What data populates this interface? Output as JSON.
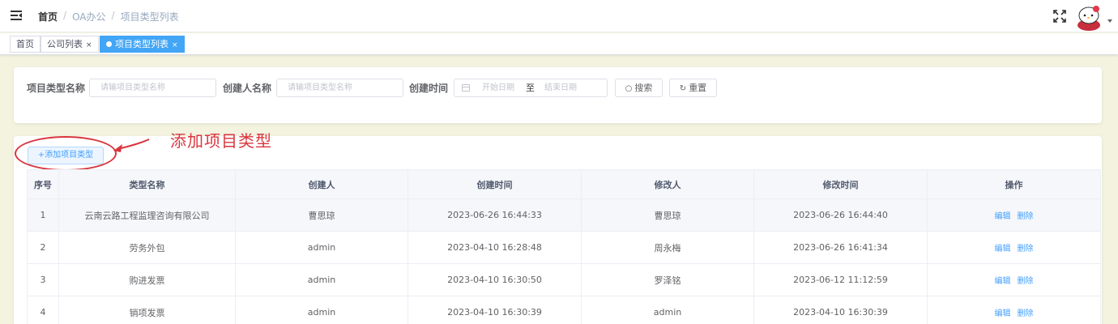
{
  "header": {
    "breadcrumb": [
      "首页",
      "OA办公",
      "项目类型列表"
    ],
    "icons": {
      "menu": "hamburger-icon",
      "fullscreen": "fullscreen-icon",
      "avatar": "hello-kitty-avatar",
      "caret": "caret-down-icon"
    }
  },
  "tags": [
    {
      "label": "首页",
      "active": false
    },
    {
      "label": "公司列表",
      "active": false,
      "closable": true
    },
    {
      "label": "项目类型列表",
      "active": true,
      "closable": true
    }
  ],
  "close_glyph": "×",
  "search": {
    "type_name_label": "项目类型名称",
    "type_name_placeholder": "请输项目类型名称",
    "creator_label": "创建人名称",
    "creator_placeholder": "请输项目类型名称",
    "time_label": "创建时间",
    "start_placeholder": "开始日期",
    "range_separator": "至",
    "end_placeholder": "结束日期",
    "search_button": "搜索",
    "reset_button": "重置"
  },
  "toolbar": {
    "add_button": "+添加项目类型",
    "annotation": "添加项目类型"
  },
  "table": {
    "columns": [
      "序号",
      "类型名称",
      "创建人",
      "创建时间",
      "修改人",
      "修改时间",
      "操作"
    ],
    "rows": [
      {
        "no": "1",
        "name": "云南云路工程监理咨询有限公司",
        "creator": "曹思琼",
        "created": "2023-06-26 16:44:33",
        "modifier": "曹思琼",
        "modified": "2023-06-26 16:44:40"
      },
      {
        "no": "2",
        "name": "劳务外包",
        "creator": "admin",
        "created": "2023-04-10 16:28:48",
        "modifier": "周永梅",
        "modified": "2023-06-26 16:41:34"
      },
      {
        "no": "3",
        "name": "购进发票",
        "creator": "admin",
        "created": "2023-04-10 16:30:50",
        "modifier": "罗泽铭",
        "modified": "2023-06-12 11:12:59"
      },
      {
        "no": "4",
        "name": "销项发票",
        "creator": "admin",
        "created": "2023-04-10 16:30:39",
        "modifier": "admin",
        "modified": "2023-04-10 16:30:39"
      }
    ],
    "edit_label": "编辑",
    "delete_label": "删除"
  },
  "colors": {
    "primary": "#409eff",
    "tag_active": "#42a5f5",
    "annotation": "#d9363e",
    "page_bg": "#f3f3e0"
  }
}
